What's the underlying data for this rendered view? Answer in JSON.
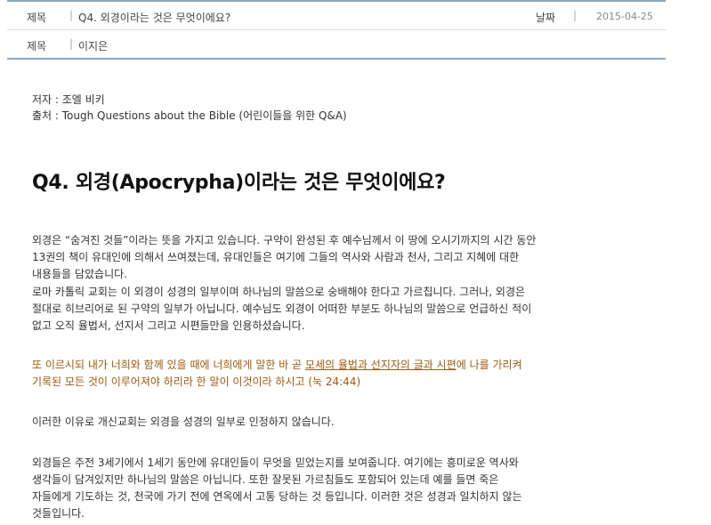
{
  "meta": {
    "title_label": "제목",
    "title_value": "Q4. 외경이라는 것은 무엇이에요?",
    "date_label": "날짜",
    "date_value": "2015-04-25",
    "author_label": "제목",
    "author_value": "이지은"
  },
  "article": {
    "author_line": "저자 : 조엘 비키",
    "source_line": "출처 : Tough Questions about the Bible (어린이들을 위한 Q&A)",
    "heading": "Q4. 외경(Apocrypha)이라는 것은 무엇이에요?",
    "p1": [
      "외경은 “숨겨진 것들”이라는 뜻을 가지고 있습니다. 구약이 완성된 후 예수님께서 이 땅에 오시기까지의 시간 동안",
      "13권의 책이 유대인에 의해서 쓰여졌는데, 유대인들은 여기에 그들의 역사와 사람과 천사, 그리고 지혜에 대한",
      "내용들을 담았습니다."
    ],
    "p2": [
      "로마 카톨릭 교회는 이 외경이 성경의 일부이며 하나님의 말씀으로 숭배해야 한다고 가르칩니다. 그러나, 외경은",
      "절대로 히브리어로 된 구약의 일부가 아닙니다. 예수님도 외경이 어떠한 부분도 하나님의 말씀으로 언급하신 적이",
      "없고 오직 율법서, 선지서 그리고 시편들만을 인용하셨습니다."
    ],
    "quote": {
      "before": "또 이르시되 내가 너희와 함께 있을 때에 너희에게 말한 바 곧 ",
      "underlined": "모세의 율법과 선지자의 글과 시편",
      "after": "에 나를 가리켜",
      "line2": "기록된 모든 것이 이루어져야 하리라 한 말이 이것이라 하시고 (눅 24:44)"
    },
    "p3": "이러한 이유로 개신교회는 외경을 성경의 일부로 인정하지 않습니다.",
    "p4": [
      "외경들은 주전 3세기에서 1세기 동안에 유대인들이 무엇을 믿었는지를 보여줍니다. 여기에는 흥미로운 역사와",
      "생각들이 담겨있지만 하나님의 말씀은 아닙니다. 또한 잘못된 가르침들도 포함되어 있는데 예를 들면 죽은",
      "자들에게 기도하는 것, 천국에 가기 전에 연옥에서 고통 당하는 것 등입니다. 이러한 것은 성경과 일치하지 않는",
      "것들입니다."
    ]
  }
}
